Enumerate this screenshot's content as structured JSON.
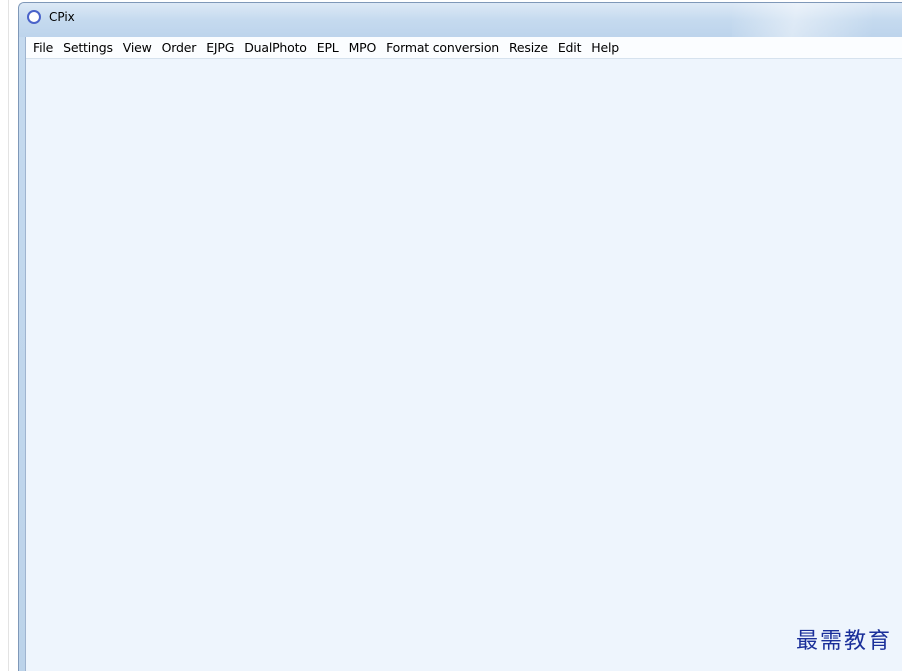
{
  "window": {
    "title": "CPix",
    "icon": "circle-app-icon"
  },
  "menubar": {
    "items": [
      {
        "label": "File"
      },
      {
        "label": "Settings"
      },
      {
        "label": "View"
      },
      {
        "label": "Order"
      },
      {
        "label": "EJPG"
      },
      {
        "label": "DualPhoto"
      },
      {
        "label": "EPL"
      },
      {
        "label": "MPO"
      },
      {
        "label": "Format conversion"
      },
      {
        "label": "Resize"
      },
      {
        "label": "Edit"
      },
      {
        "label": "Help"
      }
    ]
  },
  "watermark": {
    "text": "最需教育"
  },
  "colors": {
    "titlebar": "#c5daef",
    "client_background": "#eef5fd",
    "watermark": "#1a2f9a",
    "app_icon": "#4a63c9"
  }
}
